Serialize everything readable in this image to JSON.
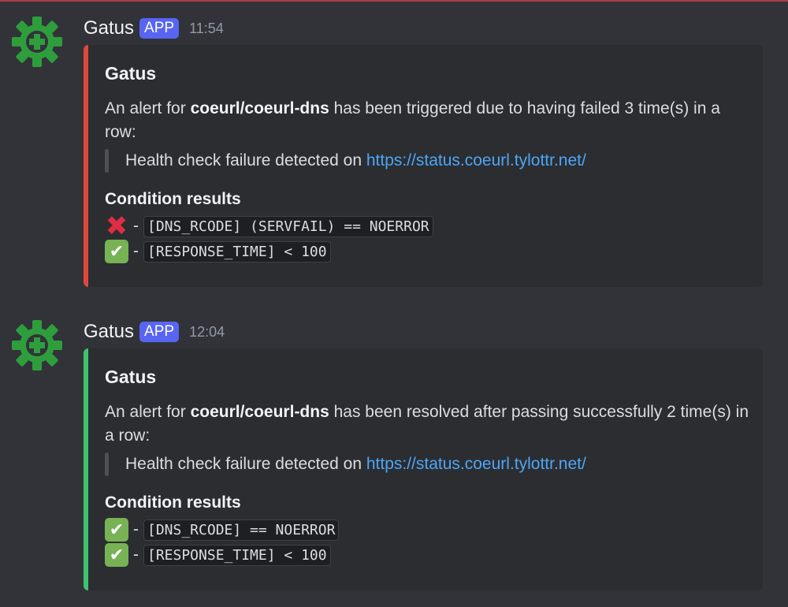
{
  "colors": {
    "alert_bar": "#e0483d",
    "resolved_bar": "#3ec46d",
    "app_badge": "#5865f2",
    "link": "#4ea6f5"
  },
  "messages": [
    {
      "author": "Gatus",
      "badge": "APP",
      "time": "11:54",
      "embed": {
        "title": "Gatus",
        "desc_prefix": "An alert for ",
        "desc_endpoint": "coeurl/coeurl-dns",
        "desc_suffix": " has been triggered due to having failed 3 time(s) in a row:",
        "quote_prefix": "Health check failure detected on ",
        "quote_link": "https://status.coeurl.tylottr.net/",
        "conditions_title": "Condition results",
        "conditions": [
          {
            "status": "cross-icon",
            "dash": "-",
            "text": "[DNS_RCODE] (SERVFAIL) == NOERROR"
          },
          {
            "status": "check-icon",
            "dash": "-",
            "text": "[RESPONSE_TIME] < 100"
          }
        ]
      }
    },
    {
      "author": "Gatus",
      "badge": "APP",
      "time": "12:04",
      "embed": {
        "title": "Gatus",
        "desc_prefix": "An alert for ",
        "desc_endpoint": "coeurl/coeurl-dns",
        "desc_suffix": " has been resolved after passing successfully 2 time(s) in a row:",
        "quote_prefix": "Health check failure detected on ",
        "quote_link": "https://status.coeurl.tylottr.net/",
        "conditions_title": "Condition results",
        "conditions": [
          {
            "status": "check-icon",
            "dash": "-",
            "text": "[DNS_RCODE] == NOERROR"
          },
          {
            "status": "check-icon",
            "dash": "-",
            "text": "[RESPONSE_TIME] < 100"
          }
        ]
      }
    }
  ]
}
